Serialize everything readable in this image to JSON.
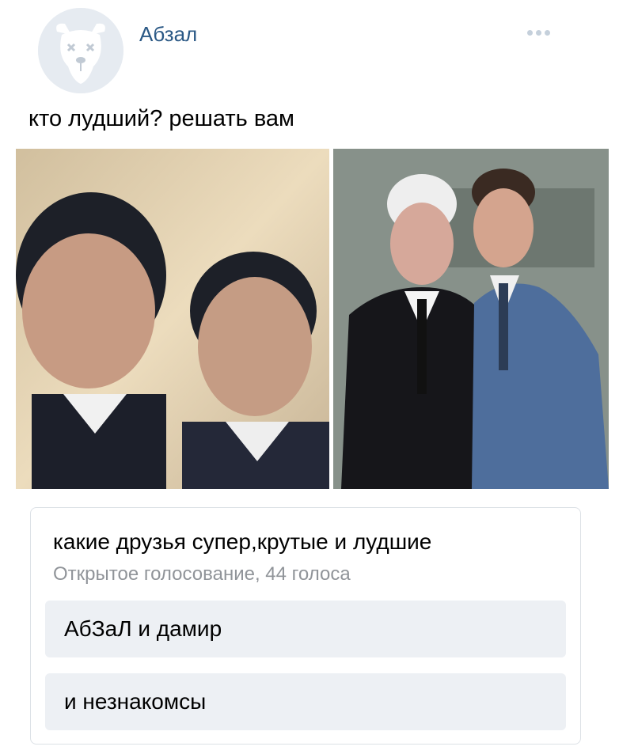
{
  "post": {
    "author": "Абзал",
    "text": "кто лудший? решать вам"
  },
  "photos": [
    {
      "name": "selfie-two-boys"
    },
    {
      "name": "two-men-in-suits"
    }
  ],
  "poll": {
    "question": "какие друзья супер,крутые и лудшие",
    "meta": "Открытое голосование, 44 голоса",
    "options": [
      {
        "label": "АбЗаЛ и дамир"
      },
      {
        "label": "и незнакомсы"
      }
    ]
  },
  "colors": {
    "author_link": "#2a5885",
    "poll_option_bg": "#edf0f4",
    "meta_text": "#909499"
  },
  "icons": {
    "avatar": "dog-avatar-icon",
    "more": "more-dots-icon"
  }
}
